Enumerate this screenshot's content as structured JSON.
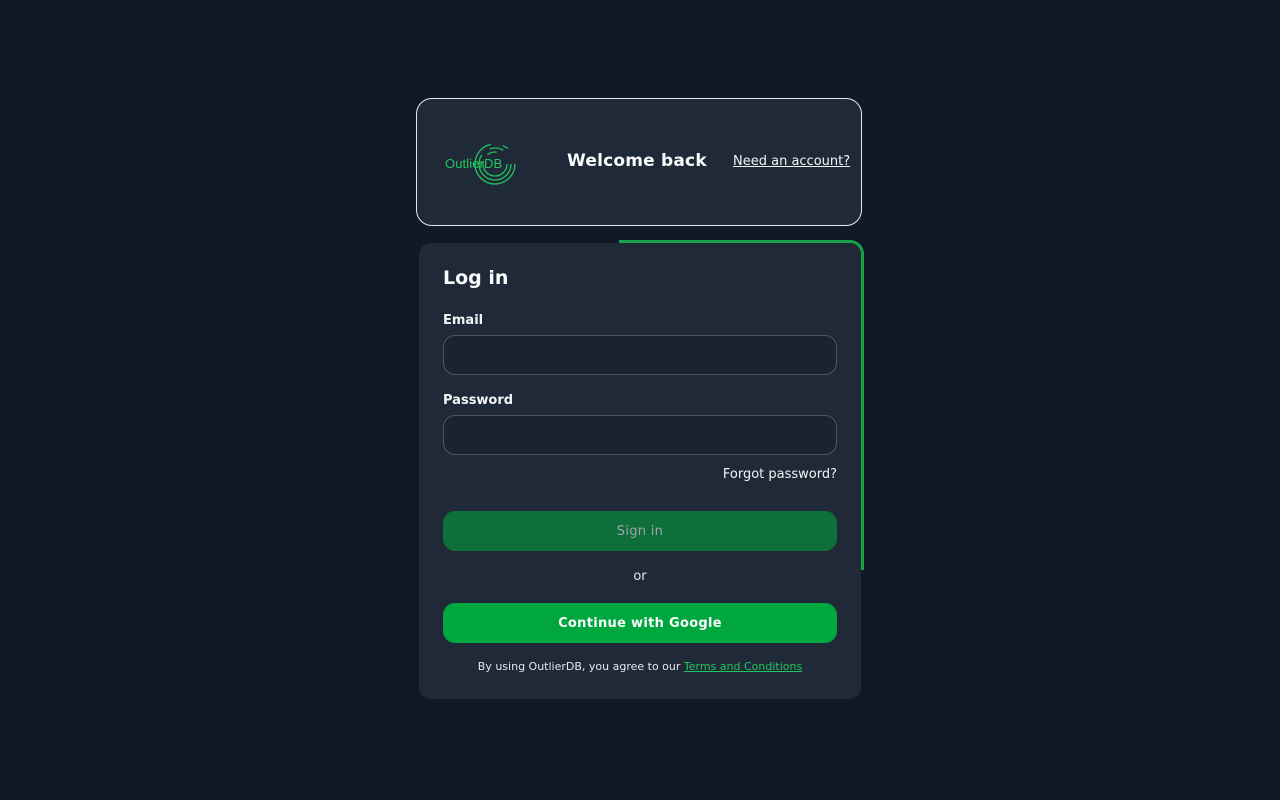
{
  "header": {
    "logo_text": "OutlierDB",
    "welcome": "Welcome back",
    "need_account": "Need an account?"
  },
  "login": {
    "title": "Log in",
    "email_label": "Email",
    "email_value": "",
    "password_label": "Password",
    "password_value": "",
    "forgot_password": "Forgot password?",
    "sign_in": "Sign in",
    "or": "or",
    "google": "Continue with Google",
    "terms_prefix": "By using OutlierDB, you agree to our ",
    "terms_link": "Terms and Conditions"
  },
  "colors": {
    "background": "#111827",
    "card": "#1f2937",
    "brand_green": "#22c55e",
    "google_button": "#00a63e",
    "signin_button": "#0f6f3a"
  },
  "icons": {
    "logo": "outlierdb-rings-logo"
  }
}
